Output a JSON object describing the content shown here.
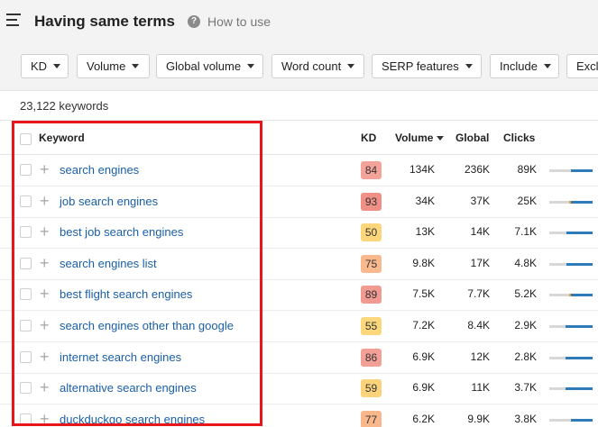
{
  "header": {
    "title": "Having same terms",
    "help_text": "How to use",
    "help_icon": "?"
  },
  "filters": [
    {
      "label": "KD"
    },
    {
      "label": "Volume"
    },
    {
      "label": "Global volume"
    },
    {
      "label": "Word count"
    },
    {
      "label": "SERP features"
    },
    {
      "label": "Include"
    },
    {
      "label": "Excl"
    }
  ],
  "summary": {
    "keyword_count": "23,122 keywords"
  },
  "table": {
    "columns": {
      "keyword": "Keyword",
      "kd": "KD",
      "volume": "Volume",
      "global": "Global",
      "clicks": "Clicks"
    },
    "rows": [
      {
        "keyword": "search engines",
        "kd": "84",
        "volume": "134K",
        "global": "236K",
        "clicks": "89K",
        "kd_color": "#f4a39a",
        "clicks_split": [
          0,
          0.5
        ]
      },
      {
        "keyword": "job search engines",
        "kd": "93",
        "volume": "34K",
        "global": "37K",
        "clicks": "25K",
        "kd_color": "#ef8f86",
        "clicks_split": [
          0.45,
          0.5
        ]
      },
      {
        "keyword": "best job search engines",
        "kd": "50",
        "volume": "13K",
        "global": "14K",
        "clicks": "7.1K",
        "kd_color": "#fbd67a",
        "clicks_split": [
          0,
          0.6
        ]
      },
      {
        "keyword": "search engines list",
        "kd": "75",
        "volume": "9.8K",
        "global": "17K",
        "clicks": "4.8K",
        "kd_color": "#f9b98c",
        "clicks_split": [
          0,
          0.6
        ]
      },
      {
        "keyword": "best flight search engines",
        "kd": "89",
        "volume": "7.5K",
        "global": "7.7K",
        "clicks": "5.2K",
        "kd_color": "#f19a91",
        "clicks_split": [
          0.45,
          0.5
        ]
      },
      {
        "keyword": "search engines other than google",
        "kd": "55",
        "volume": "7.2K",
        "global": "8.4K",
        "clicks": "2.9K",
        "kd_color": "#fcd77c",
        "clicks_split": [
          0,
          0.62
        ]
      },
      {
        "keyword": "internet search engines",
        "kd": "86",
        "volume": "6.9K",
        "global": "12K",
        "clicks": "2.8K",
        "kd_color": "#f3a096",
        "clicks_split": [
          0,
          0.62
        ]
      },
      {
        "keyword": "alternative search engines",
        "kd": "59",
        "volume": "6.9K",
        "global": "11K",
        "clicks": "3.7K",
        "kd_color": "#fcd37a",
        "clicks_split": [
          0,
          0.62
        ]
      },
      {
        "keyword": "duckduckgo search engines",
        "kd": "77",
        "volume": "6.2K",
        "global": "9.9K",
        "clicks": "3.8K",
        "kd_color": "#f9b78c",
        "clicks_split": [
          0,
          0.5
        ]
      }
    ]
  },
  "colors": {
    "link": "#1a5fa8",
    "highlight_box": "#e8151d",
    "clicks_organic": "#2f7ab8",
    "clicks_paid": "#f0a030"
  }
}
